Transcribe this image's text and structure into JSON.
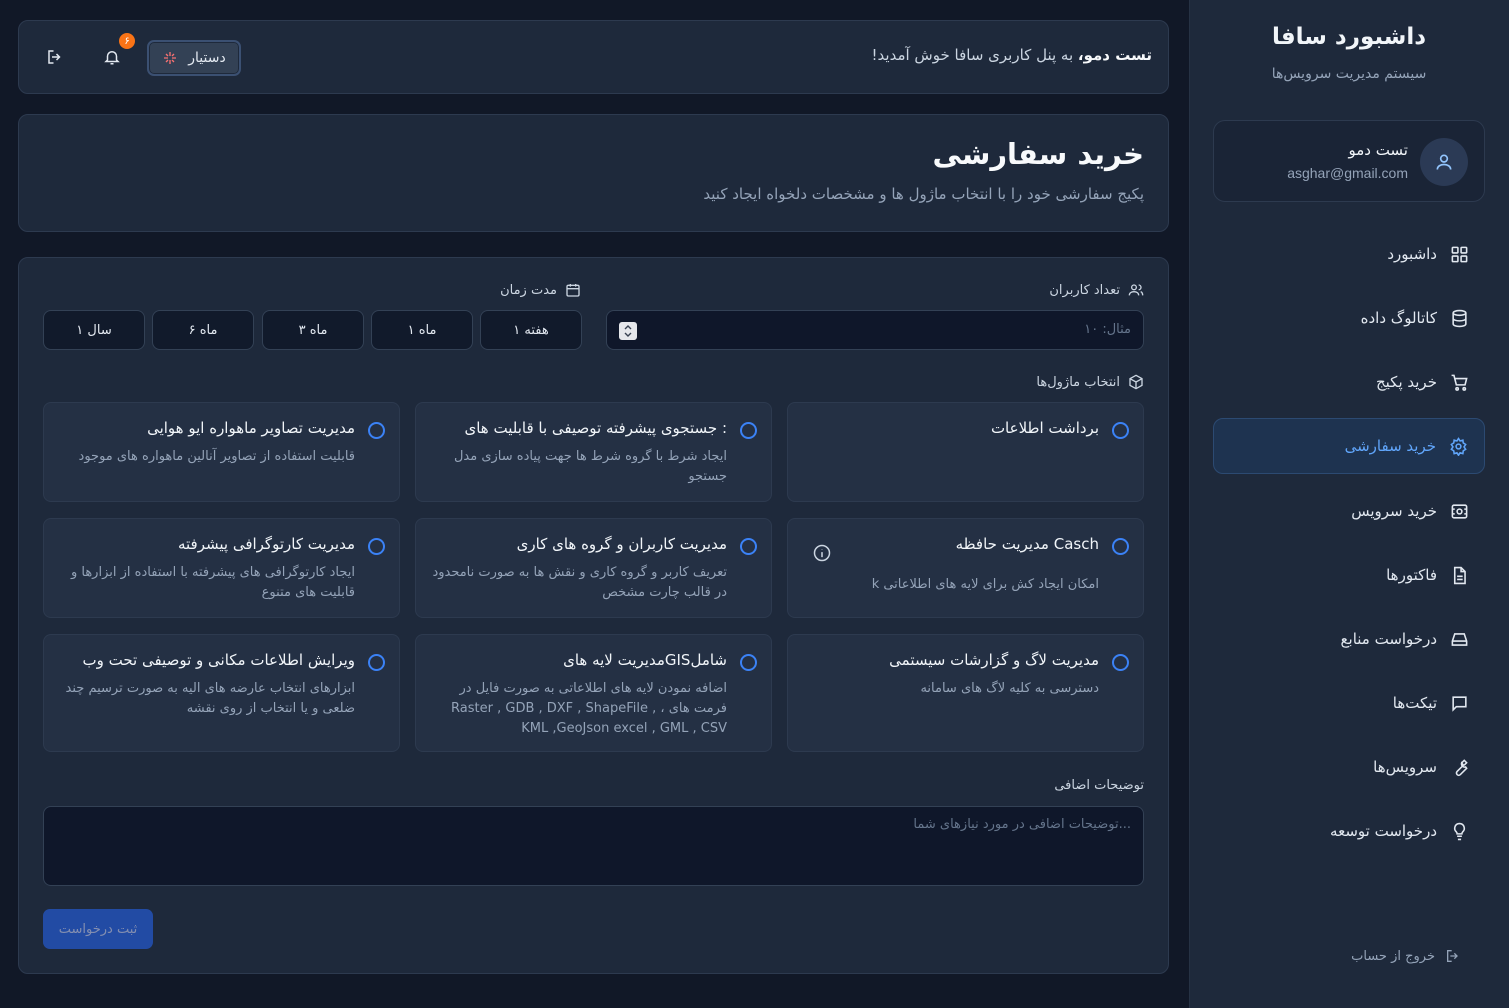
{
  "sidebar": {
    "title": "داشبورد سافا",
    "subtitle": "سیستم مدیریت سرویس‌ها",
    "user": {
      "name": "تست دمو",
      "email": "asghar@gmail.com"
    },
    "items": [
      {
        "label": "داشبورد",
        "icon": "grid-icon"
      },
      {
        "label": "کاتالوگ داده",
        "icon": "database-icon"
      },
      {
        "label": "خرید پکیج",
        "icon": "cart-icon"
      },
      {
        "label": "خرید سفارشی",
        "icon": "gear-icon",
        "active": true
      },
      {
        "label": "خرید سرویس",
        "icon": "service-icon"
      },
      {
        "label": "فاکتورها",
        "icon": "document-icon"
      },
      {
        "label": "درخواست منابع",
        "icon": "drive-icon"
      },
      {
        "label": "تیکت‌ها",
        "icon": "message-icon"
      },
      {
        "label": "سرویس‌ها",
        "icon": "wrench-icon"
      },
      {
        "label": "درخواست توسعه",
        "icon": "bulb-icon"
      }
    ],
    "logout": "خروج از حساب"
  },
  "topbar": {
    "welcome_name": "تست دمو،",
    "welcome_text": " به پنل کاربری سافا خوش آمدید!",
    "assistant_label": "دستیار",
    "notification_count": "۶"
  },
  "header": {
    "title": "خرید سفارشی",
    "subtitle": "پکیج سفارشی خود را با انتخاب ماژول ها و مشخصات دلخواه ایجاد کنید"
  },
  "form": {
    "users_label": "تعداد کاربران",
    "users_placeholder": "مثال: ۱۰",
    "duration_label": "مدت زمان",
    "durations": [
      "۱ هفته",
      "۱ ماه",
      "۳ ماه",
      "۶ ماه",
      "۱ سال"
    ],
    "modules_label": "انتخاب ماژول‌ها",
    "modules": [
      {
        "title": "برداشت اطلاعات",
        "desc": ""
      },
      {
        "title": "جستجوی پیشرفته توصیفی با قابلیت های :",
        "desc": "ایجاد شرط با گروه شرط ها جهت پیاده سازی مدل جستجو"
      },
      {
        "title": "مدیریت تصاویر ماهواره ایو هوایی",
        "desc": "قابلیت استفاده از تصاویر آنالین ماهواره های موجود"
      },
      {
        "title": "مدیریت حافظه Casch",
        "desc": "امکان ایجاد کش برای لایه های اطلاعاتی k"
      },
      {
        "title": "مدیریت کاربران و گروه های کاری",
        "desc": "تعریف کاربر و گروه کاری و نقش ها به صورت نامحدود در قالب چارت مشخص"
      },
      {
        "title": "مدیریت کارتوگرافی پیشرفته",
        "desc": "ایجاد کارتوگرافی های پیشرفته با استفاده از ابزارها و قابلیت های متنوع"
      },
      {
        "title": "مدیریت لاگ و گزارشات سیستمی",
        "desc": "دسترسی به کلیه لاگ های سامانه"
      },
      {
        "title": "مدیریت لایه هایGISشامل",
        "desc": "اضافه نمودن لایه های اطلاعاتی به صورت فایل در فرمت های ، Raster , GDB , DXF , ShapeFile , KML ,GeoJson excel , GML , CSV"
      },
      {
        "title": "ویرایش اطلاعات مکانی و توصیفی تحت وب",
        "desc": "ابزارهای انتخاب عارضه های الیه به صورت ترسیم چند ضلعی و یا انتخاب از روی نقشه"
      }
    ],
    "notes_label": "توضیحات اضافی",
    "notes_placeholder": "توضیحات اضافی در مورد نیازهای شما...",
    "submit_label": "ثبت درخواست"
  },
  "colors": {
    "accent": "#3b82f6",
    "badge": "#f97316",
    "background": "#111827",
    "panel": "#1e293b"
  }
}
